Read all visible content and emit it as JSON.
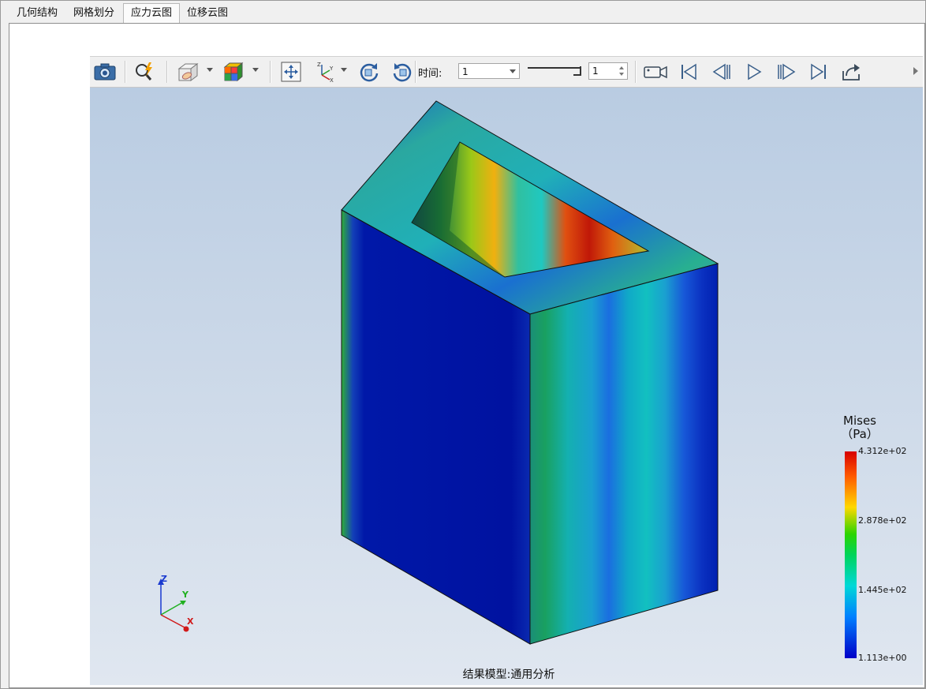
{
  "tabs": [
    {
      "label": "几何结构",
      "active": false
    },
    {
      "label": "网格划分",
      "active": false
    },
    {
      "label": "应力云图",
      "active": true
    },
    {
      "label": "位移云图",
      "active": false
    }
  ],
  "toolbar": {
    "screenshot_icon": "camera-icon",
    "query_icon": "magnifier-lightning-icon",
    "display_mode_icon": "box-display-icon",
    "color_map_icon": "color-cube-icon",
    "fit_view_icon": "fit-view-icon",
    "axes_icon": "xyz-axes-icon",
    "rotate_cw_icon": "rotate-cw-icon",
    "rotate_ccw_icon": "rotate-ccw-icon",
    "time_label": "时间:",
    "time_value": "1",
    "frame_value": "1",
    "record_icon": "video-camera-icon",
    "first_frame_icon": "first-frame-icon",
    "prev_frame_icon": "prev-frame-icon",
    "play_icon": "play-icon",
    "next_frame_icon": "next-frame-icon",
    "last_frame_icon": "last-frame-icon",
    "export_icon": "export-icon"
  },
  "legend": {
    "title_line1": "Mises",
    "title_line2": "（Pa）",
    "max": "4.312e+02",
    "mid_high": "2.878e+02",
    "mid_low": "1.445e+02",
    "min": "1.113e+00",
    "colors": {
      "high": "#d70000",
      "mid": "#2bd400",
      "low": "#0000c8"
    }
  },
  "triad": {
    "z": "Z",
    "y": "Y",
    "x": "X"
  },
  "caption": "结果模型:通用分析"
}
